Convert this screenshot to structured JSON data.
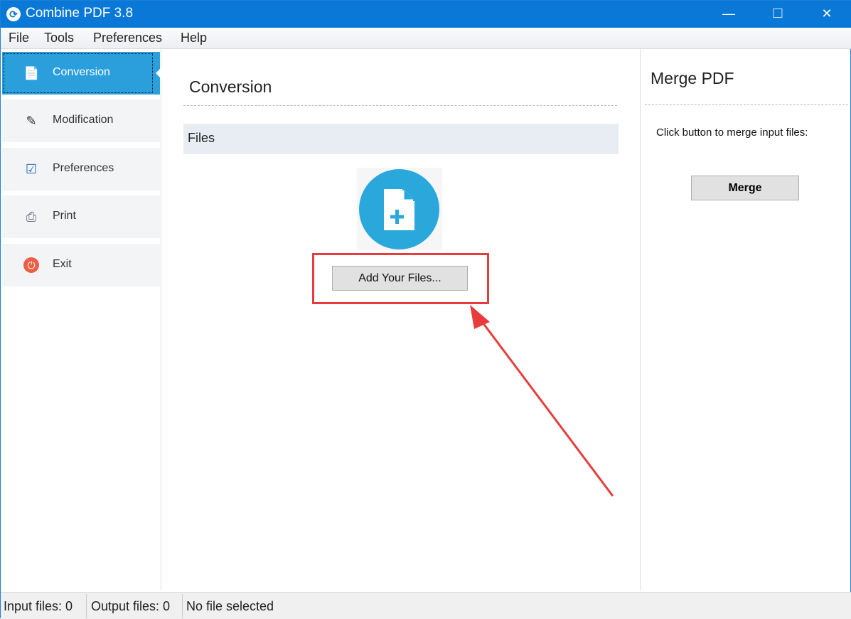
{
  "window": {
    "title": "Combine PDF 3.8",
    "minimize": "—",
    "maximize": "☐",
    "close": "✕"
  },
  "menu": [
    "File",
    "Tools",
    "Preferences",
    "Help"
  ],
  "sidebar": {
    "items": [
      {
        "label": "Conversion",
        "icon": "document-convert-icon"
      },
      {
        "label": "Modification",
        "icon": "document-edit-icon"
      },
      {
        "label": "Preferences",
        "icon": "checkbox-settings-icon"
      },
      {
        "label": "Print",
        "icon": "printer-icon"
      },
      {
        "label": "Exit",
        "icon": "power-icon"
      }
    ]
  },
  "main": {
    "title": "Conversion",
    "files_header": "Files",
    "add_button": "Add Your Files..."
  },
  "right": {
    "title": "Merge PDF",
    "instruction": "Click button to merge input files:",
    "merge_button": "Merge"
  },
  "status": {
    "input": "Input files: 0",
    "output": "Output files: 0",
    "selection": "No file selected"
  },
  "colors": {
    "accent": "#2b9fdc",
    "titlebar": "#0a78d7",
    "annotation": "#e83c3c"
  }
}
